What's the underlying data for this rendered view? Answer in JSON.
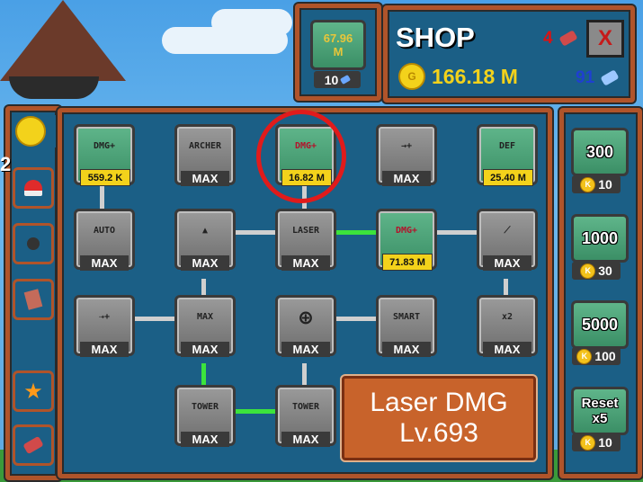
{
  "gem_pack": {
    "amount_line1": "67.96",
    "amount_line2": "M",
    "price": "10"
  },
  "shop": {
    "title": "SHOP",
    "red_gems": "4",
    "gold": "166.18 M",
    "blue_gems": "91",
    "close": "X"
  },
  "left": {
    "count": "2"
  },
  "tiles": {
    "t1": {
      "icon": "DMG+",
      "label": "559.2 K"
    },
    "t2": {
      "icon": "ARCHER",
      "label": "MAX"
    },
    "t3": {
      "icon": "DMG+",
      "label": "16.82 M"
    },
    "t4": {
      "icon": "",
      "label": "MAX"
    },
    "t5": {
      "icon": "DEF",
      "label": "25.40 M"
    },
    "t6": {
      "icon": "AUTO",
      "label": "MAX"
    },
    "t7": {
      "icon": "",
      "label": "MAX"
    },
    "t8": {
      "icon": "LASER",
      "label": "MAX"
    },
    "t9": {
      "icon": "DMG+",
      "label": "71.83 M"
    },
    "t10": {
      "icon": "",
      "label": "MAX"
    },
    "t11": {
      "icon": "",
      "label": "MAX"
    },
    "t12": {
      "icon": "MAX",
      "label": "MAX"
    },
    "t13": {
      "icon": "",
      "label": "MAX"
    },
    "t14": {
      "icon": "SMART",
      "label": "MAX"
    },
    "t15": {
      "icon": "x2",
      "label": "MAX"
    },
    "t16": {
      "icon": "TOWER",
      "label": "MAX"
    },
    "t17": {
      "icon": "TOWER",
      "label": "MAX"
    }
  },
  "info": {
    "line1": "Laser DMG",
    "line2": "Lv.693"
  },
  "packs": [
    {
      "amount": "300",
      "price": "10"
    },
    {
      "amount": "1000",
      "price": "30"
    },
    {
      "amount": "5000",
      "price": "100"
    },
    {
      "amount": "Reset x5",
      "price": "10"
    }
  ],
  "colors": {
    "frame": "#b0542a",
    "panel": "#1b5f86",
    "gold": "#f3d21b",
    "active_line": "#3ce33c",
    "highlight": "#e01b1b"
  }
}
